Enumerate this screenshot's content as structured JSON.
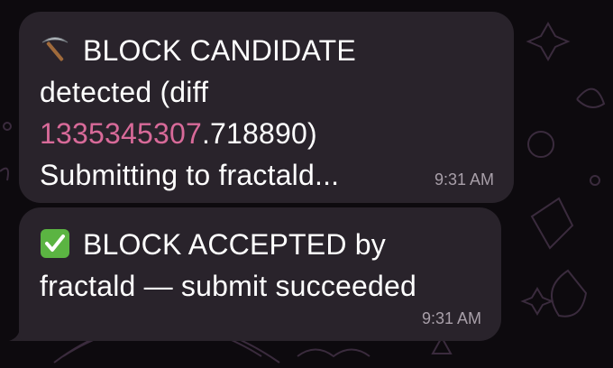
{
  "messages": [
    {
      "icon": "pickaxe-icon",
      "title": "BLOCK CANDIDATE",
      "line2": "detected (diff",
      "diff_highlight": "1335345307",
      "diff_rest": ".718890)",
      "line4": "Submitting to fractald...",
      "time": "9:31 AM"
    },
    {
      "icon": "check-mark-icon",
      "title": "BLOCK ACCEPTED by",
      "line2": "fractald — submit succeeded",
      "time": "9:31 AM"
    }
  ],
  "colors": {
    "bubble": "#29232b",
    "highlight": "#d86a99",
    "check": "#5bb442",
    "timestamp": "#a89fa9"
  }
}
